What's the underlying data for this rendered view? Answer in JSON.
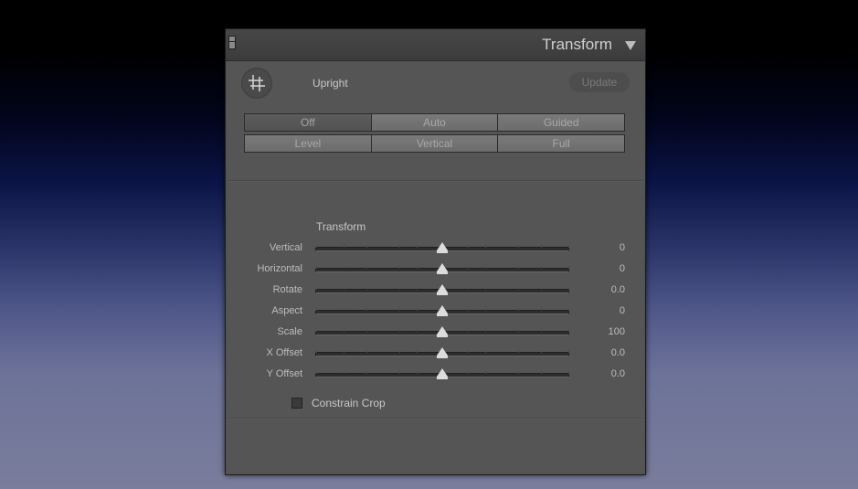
{
  "panel": {
    "title": "Transform",
    "collapse_icon": "triangle-down-icon"
  },
  "upright": {
    "crop_icon": "crop-grid-icon",
    "label": "Upright",
    "update_label": "Update",
    "modes": [
      [
        "Off",
        "Auto",
        "Guided"
      ],
      [
        "Level",
        "Vertical",
        "Full"
      ]
    ],
    "active_mode": "Off"
  },
  "transform": {
    "title": "Transform",
    "sliders": [
      {
        "label": "Vertical",
        "value": "0",
        "position": 0.5
      },
      {
        "label": "Horizontal",
        "value": "0",
        "position": 0.5
      },
      {
        "label": "Rotate",
        "value": "0.0",
        "position": 0.5
      },
      {
        "label": "Aspect",
        "value": "0",
        "position": 0.5
      },
      {
        "label": "Scale",
        "value": "100",
        "position": 0.5
      },
      {
        "label": "X Offset",
        "value": "0.0",
        "position": 0.5
      },
      {
        "label": "Y Offset",
        "value": "0.0",
        "position": 0.5
      }
    ]
  },
  "constrain_crop": {
    "label": "Constrain Crop",
    "checked": false
  }
}
